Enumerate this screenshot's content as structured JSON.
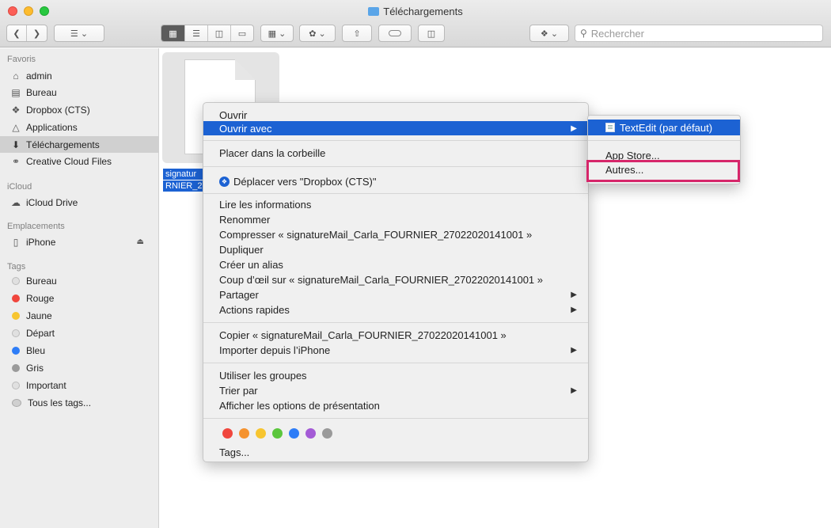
{
  "window": {
    "title": "Téléchargements"
  },
  "toolbar": {
    "search_placeholder": "Rechercher",
    "icons": [
      "back-icon",
      "forward-icon",
      "list-view-icon",
      "icon-view-icon",
      "column-view-icon",
      "gallery-view-icon",
      "group-icon",
      "gear-icon",
      "share-icon",
      "tag-icon",
      "trash-icon",
      "dropbox-icon",
      "search-icon"
    ]
  },
  "sidebar": {
    "favorites_header": "Favoris",
    "favorites": [
      {
        "label": "admin",
        "icon": "home-icon"
      },
      {
        "label": "Bureau",
        "icon": "desktop-icon"
      },
      {
        "label": "Dropbox (CTS)",
        "icon": "dropbox-icon"
      },
      {
        "label": "Applications",
        "icon": "applications-icon"
      },
      {
        "label": "Téléchargements",
        "icon": "download-icon",
        "selected": true
      },
      {
        "label": "Creative Cloud Files",
        "icon": "creative-cloud-icon"
      }
    ],
    "icloud_header": "iCloud",
    "icloud": [
      {
        "label": "iCloud Drive",
        "icon": "cloud-icon"
      }
    ],
    "locations_header": "Emplacements",
    "locations": [
      {
        "label": "iPhone",
        "icon": "iphone-icon"
      }
    ],
    "tags_header": "Tags",
    "tags": [
      {
        "label": "Bureau",
        "color": "#e0e0e0"
      },
      {
        "label": "Rouge",
        "color": "#f0463d"
      },
      {
        "label": "Jaune",
        "color": "#f7c530"
      },
      {
        "label": "Départ",
        "color": "#e0e0e0"
      },
      {
        "label": "Bleu",
        "color": "#2e7df7"
      },
      {
        "label": "Gris",
        "color": "#9a9a9a"
      },
      {
        "label": "Important",
        "color": "#e0e0e0"
      },
      {
        "label": "Tous les tags...",
        "color": "#d0d0d0"
      }
    ]
  },
  "file": {
    "name_line1": "signatur",
    "name_line2": "RNIER_2"
  },
  "context_menu": {
    "open": "Ouvrir",
    "open_with": "Ouvrir avec",
    "move_to_trash": "Placer dans la corbeille",
    "move_to_dropbox": "Déplacer vers \"Dropbox (CTS)\"",
    "get_info": "Lire les informations",
    "rename": "Renommer",
    "compress": "Compresser « signatureMail_Carla_FOURNIER_27022020141001 »",
    "duplicate": "Dupliquer",
    "make_alias": "Créer un alias",
    "quick_look": "Coup d’œil sur « signatureMail_Carla_FOURNIER_27022020141001 »",
    "share": "Partager",
    "quick_actions": "Actions rapides",
    "copy": "Copier « signatureMail_Carla_FOURNIER_27022020141001 »",
    "import_iphone": "Importer depuis l’iPhone",
    "use_groups": "Utiliser les groupes",
    "sort_by": "Trier par",
    "show_view_options": "Afficher les options de présentation",
    "tag_colors": [
      "#f0463d",
      "#f5932f",
      "#f7c530",
      "#5bc63c",
      "#2e7df7",
      "#a45bd6",
      "#9a9a9a"
    ],
    "tags": "Tags..."
  },
  "submenu": {
    "textedit": "TextEdit (par défaut)",
    "app_store": "App Store...",
    "others": "Autres..."
  },
  "highlight_color": "#d6266a",
  "accent_color": "#1c62d3"
}
